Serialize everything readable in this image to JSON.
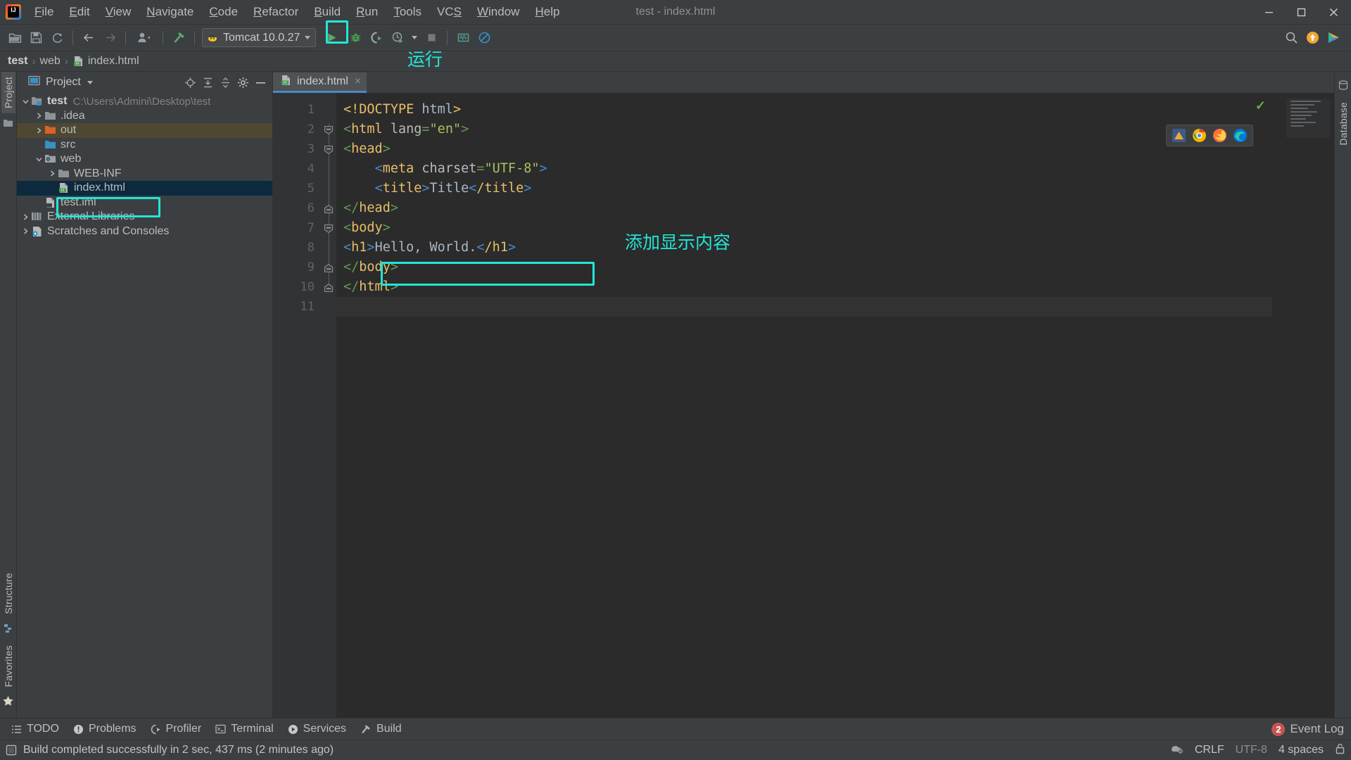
{
  "window": {
    "title": "test - index.html",
    "controls": [
      "minimize",
      "maximize",
      "close"
    ]
  },
  "menubar": {
    "logo": "intellij-idea-logo",
    "items": [
      {
        "label": "File",
        "mnemonic": "F"
      },
      {
        "label": "Edit",
        "mnemonic": "E"
      },
      {
        "label": "View",
        "mnemonic": "V"
      },
      {
        "label": "Navigate",
        "mnemonic": "N"
      },
      {
        "label": "Code",
        "mnemonic": "C"
      },
      {
        "label": "Refactor",
        "mnemonic": "R"
      },
      {
        "label": "Build",
        "mnemonic": "B"
      },
      {
        "label": "Run",
        "mnemonic": "R"
      },
      {
        "label": "Tools",
        "mnemonic": "T"
      },
      {
        "label": "VCS",
        "mnemonic": "S"
      },
      {
        "label": "Window",
        "mnemonic": "W"
      },
      {
        "label": "Help",
        "mnemonic": "H"
      }
    ]
  },
  "toolbar": {
    "open_icon": "open-folder-icon",
    "save_icon": "save-icon",
    "sync_icon": "refresh-icon",
    "back_icon": "arrow-left-icon",
    "forward_icon": "arrow-right-icon",
    "profile_icon": "user-icon",
    "build_icon": "hammer-icon",
    "run_config": {
      "name": "Tomcat 10.0.27",
      "icon": "tomcat-icon",
      "dropdown": "chevron-down-icon"
    },
    "run_icon": "run-play-icon",
    "debug_icon": "debug-bug-icon",
    "run_coverage_icon": "run-with-coverage-icon",
    "profiler_icon": "profiler-clock-icon",
    "profiler_dropdown": "chevron-down-icon",
    "stop_icon": "stop-square-icon",
    "monitor_icon": "activity-monitor-icon",
    "noop_icon": "no-entry-icon",
    "search_icon": "search-icon",
    "updates_icon": "update-arrow-icon",
    "ide_icon": "ide-badge-icon"
  },
  "breadcrumb": {
    "separator": "›",
    "items": [
      {
        "label": "test",
        "bold": true
      },
      {
        "label": "web",
        "bold": false
      },
      {
        "label": "index.html",
        "bold": false,
        "icon": "html-file-icon"
      }
    ]
  },
  "left_stripe": {
    "project_tab": "Project",
    "structure_tab": "Structure",
    "favorites_tab": "Favorites",
    "folder_icon": "folder-icon",
    "structure_icon": "structure-icon",
    "favorites_icon": "star-icon"
  },
  "right_stripe": {
    "database_tab": "Database",
    "database_icon": "database-icon"
  },
  "project_panel": {
    "title": "Project",
    "title_icon": "project-view-icon",
    "dropdown_icon": "chevron-down-icon",
    "actions": [
      {
        "name": "locate-icon"
      },
      {
        "name": "expand-all-icon"
      },
      {
        "name": "collapse-all-icon"
      },
      {
        "name": "settings-gear-icon"
      },
      {
        "name": "hide-panel-icon"
      }
    ],
    "tree": [
      {
        "label": "test",
        "path": "C:\\Users\\Admini\\Desktop\\test",
        "indent": 0,
        "arrow": "expanded",
        "icon": "module-folder-icon",
        "bold": true,
        "state": "normal"
      },
      {
        "label": ".idea",
        "path": "",
        "indent": 1,
        "arrow": "collapsed",
        "icon": "folder-gray-icon",
        "bold": false,
        "state": "normal"
      },
      {
        "label": "out",
        "path": "",
        "indent": 1,
        "arrow": "collapsed",
        "icon": "folder-orange-icon",
        "bold": false,
        "state": "highlight"
      },
      {
        "label": "src",
        "path": "",
        "indent": 1,
        "arrow": "none",
        "icon": "folder-source-icon",
        "bold": false,
        "state": "normal"
      },
      {
        "label": "web",
        "path": "",
        "indent": 1,
        "arrow": "expanded",
        "icon": "folder-web-icon",
        "bold": false,
        "state": "normal"
      },
      {
        "label": "WEB-INF",
        "path": "",
        "indent": 2,
        "arrow": "collapsed",
        "icon": "folder-gray-icon",
        "bold": false,
        "state": "normal"
      },
      {
        "label": "index.html",
        "path": "",
        "indent": 2,
        "arrow": "none",
        "icon": "html-file-icon",
        "bold": false,
        "state": "selected"
      },
      {
        "label": "test.iml",
        "path": "",
        "indent": 1,
        "arrow": "none",
        "icon": "iml-file-icon",
        "bold": false,
        "state": "normal"
      },
      {
        "label": "External Libraries",
        "path": "",
        "indent": 0,
        "arrow": "collapsed",
        "icon": "libraries-icon",
        "bold": false,
        "state": "normal"
      },
      {
        "label": "Scratches and Consoles",
        "path": "",
        "indent": 0,
        "arrow": "collapsed",
        "icon": "scratches-icon",
        "bold": false,
        "state": "normal"
      }
    ]
  },
  "editor": {
    "tab": {
      "label": "index.html",
      "icon": "html-file-icon",
      "close": "×"
    },
    "inspection_status": "✓",
    "browser_icons": [
      "ide-browser-icon",
      "chrome-icon",
      "firefox-icon",
      "edge-icon"
    ],
    "lines": [
      {
        "n": "1",
        "fold": "none",
        "tokens": [
          {
            "t": "<!DOCTYPE ",
            "c": "doc"
          },
          {
            "t": "html",
            "c": "txt"
          },
          {
            "t": ">",
            "c": "doc"
          }
        ],
        "indent": 0
      },
      {
        "n": "2",
        "fold": "open",
        "tokens": [
          {
            "t": "<",
            "c": "br"
          },
          {
            "t": "html ",
            "c": "tag"
          },
          {
            "t": "lang",
            "c": "attr"
          },
          {
            "t": "=",
            "c": "br"
          },
          {
            "t": "\"en\"",
            "c": "val"
          },
          {
            "t": ">",
            "c": "br"
          }
        ],
        "indent": 0
      },
      {
        "n": "3",
        "fold": "open",
        "tokens": [
          {
            "t": "<",
            "c": "br"
          },
          {
            "t": "head",
            "c": "tag"
          },
          {
            "t": ">",
            "c": "br"
          }
        ],
        "indent": 0
      },
      {
        "n": "4",
        "fold": "none",
        "tokens": [
          {
            "t": "<",
            "c": "lt"
          },
          {
            "t": "meta ",
            "c": "tag"
          },
          {
            "t": "charset",
            "c": "attr"
          },
          {
            "t": "=",
            "c": "br"
          },
          {
            "t": "\"UTF-8\"",
            "c": "val"
          },
          {
            "t": ">",
            "c": "lt"
          }
        ],
        "indent": 1
      },
      {
        "n": "5",
        "fold": "none",
        "tokens": [
          {
            "t": "<",
            "c": "lt"
          },
          {
            "t": "title",
            "c": "tag"
          },
          {
            "t": ">",
            "c": "lt"
          },
          {
            "t": "Title",
            "c": "txt"
          },
          {
            "t": "<",
            "c": "lt"
          },
          {
            "t": "/title",
            "c": "tag"
          },
          {
            "t": ">",
            "c": "lt"
          }
        ],
        "indent": 1
      },
      {
        "n": "6",
        "fold": "close",
        "tokens": [
          {
            "t": "</",
            "c": "br"
          },
          {
            "t": "head",
            "c": "tag"
          },
          {
            "t": ">",
            "c": "br"
          }
        ],
        "indent": 0
      },
      {
        "n": "7",
        "fold": "open",
        "tokens": [
          {
            "t": "<",
            "c": "br"
          },
          {
            "t": "body",
            "c": "tag"
          },
          {
            "t": ">",
            "c": "br"
          }
        ],
        "indent": 0
      },
      {
        "n": "8",
        "fold": "none",
        "tokens": [
          {
            "t": "<",
            "c": "lt"
          },
          {
            "t": "h1",
            "c": "tag"
          },
          {
            "t": ">",
            "c": "lt"
          },
          {
            "t": "Hello, World.",
            "c": "txt"
          },
          {
            "t": "<",
            "c": "lt"
          },
          {
            "t": "/h1",
            "c": "tag"
          },
          {
            "t": ">",
            "c": "lt"
          }
        ],
        "indent": 0
      },
      {
        "n": "9",
        "fold": "close",
        "tokens": [
          {
            "t": "</",
            "c": "br"
          },
          {
            "t": "body",
            "c": "tag"
          },
          {
            "t": ">",
            "c": "br"
          }
        ],
        "indent": 0
      },
      {
        "n": "10",
        "fold": "close",
        "tokens": [
          {
            "t": "</",
            "c": "br"
          },
          {
            "t": "html",
            "c": "tag"
          },
          {
            "t": ">",
            "c": "br"
          }
        ],
        "indent": 0
      },
      {
        "n": "11",
        "fold": "none",
        "tokens": [],
        "indent": 0
      }
    ]
  },
  "annotations": [
    {
      "text": "运行",
      "role": "run-button-callout"
    },
    {
      "text": "添加显示内容",
      "role": "add-content-callout"
    }
  ],
  "bottom_bar": {
    "items": [
      {
        "label": "TODO",
        "icon": "todo-list-icon"
      },
      {
        "label": "Problems",
        "icon": "problems-warning-icon"
      },
      {
        "label": "Profiler",
        "icon": "profiler-icon"
      },
      {
        "label": "Terminal",
        "icon": "terminal-icon"
      },
      {
        "label": "Services",
        "icon": "services-play-icon"
      },
      {
        "label": "Build",
        "icon": "build-hammer-icon"
      }
    ],
    "event_log": {
      "label": "Event Log",
      "count": "2"
    }
  },
  "status_bar": {
    "message": "Build completed successfully in 2 sec, 437 ms (2 minutes ago)",
    "message_icon": "build-status-icon",
    "right": [
      {
        "name": "inspections-icon",
        "label": ""
      },
      {
        "name": "line-separator",
        "label": "CRLF"
      },
      {
        "name": "file-encoding",
        "label": "UTF-8"
      },
      {
        "name": "indent-setting",
        "label": "4 spaces"
      },
      {
        "name": "lock-icon",
        "label": ""
      }
    ]
  },
  "colors": {
    "accent_teal": "#22e6d8",
    "tab_underline": "#4a88c7",
    "selection": "#0d293e",
    "highlight_row": "#4e4833",
    "run_green": "#59a869",
    "badge_red": "#c75450"
  }
}
